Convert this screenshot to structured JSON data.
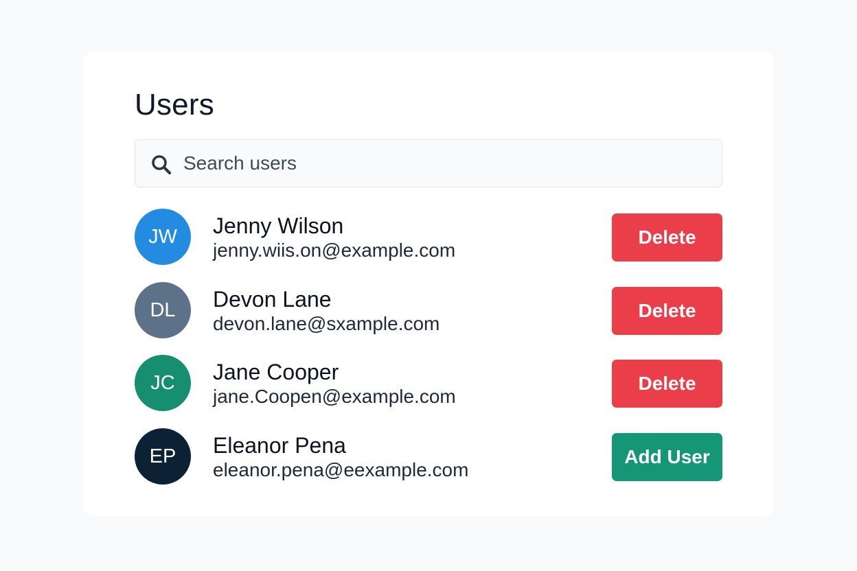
{
  "panel": {
    "title": "Users"
  },
  "search": {
    "placeholder": "Search users",
    "icon": "search-icon"
  },
  "users": [
    {
      "initials": "JW",
      "name": "Jenny Wilson",
      "email": "jenny.wiis.on@example.com",
      "avatar_color": "#238ce0",
      "action_label": "Delete",
      "action_color": "#ea3f4b"
    },
    {
      "initials": "DL",
      "name": "Devon Lane",
      "email": "devon.lane@sxample.com",
      "avatar_color": "#5d7189",
      "action_label": "Delete",
      "action_color": "#ea3f4b"
    },
    {
      "initials": "JC",
      "name": "Jane Cooper",
      "email": "jane.Coopen@example.com",
      "avatar_color": "#168f70",
      "action_label": "Delete",
      "action_color": "#ea3f4b"
    },
    {
      "initials": "EP",
      "name": "Eleanor Pena",
      "email": "eleanor.pena@eexample.com",
      "avatar_color": "#0c2134",
      "action_label": "Add User",
      "action_color": "#159676"
    }
  ]
}
